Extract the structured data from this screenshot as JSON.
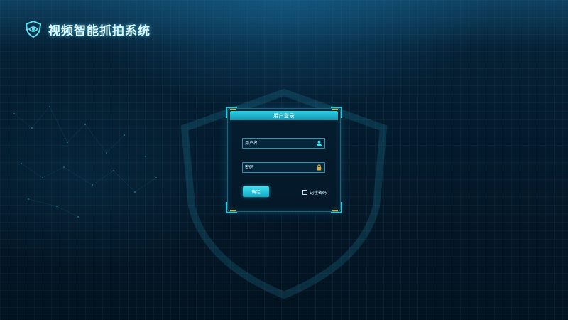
{
  "app": {
    "title": "视频智能抓拍系统",
    "logo_icon": "shield-eye-icon"
  },
  "login": {
    "title": "用户登录",
    "username": {
      "placeholder": "用户名",
      "value": "",
      "icon": "user-icon"
    },
    "password": {
      "placeholder": "密码",
      "value": "",
      "icon": "lock-icon"
    },
    "submit_label": "确定",
    "remember_label": "记住密码",
    "remember_checked": false
  },
  "colors": {
    "accent": "#2cd3e4",
    "accent_dark": "#1596b3",
    "corner_highlight": "#e2b33a",
    "background": "#041a2c"
  }
}
